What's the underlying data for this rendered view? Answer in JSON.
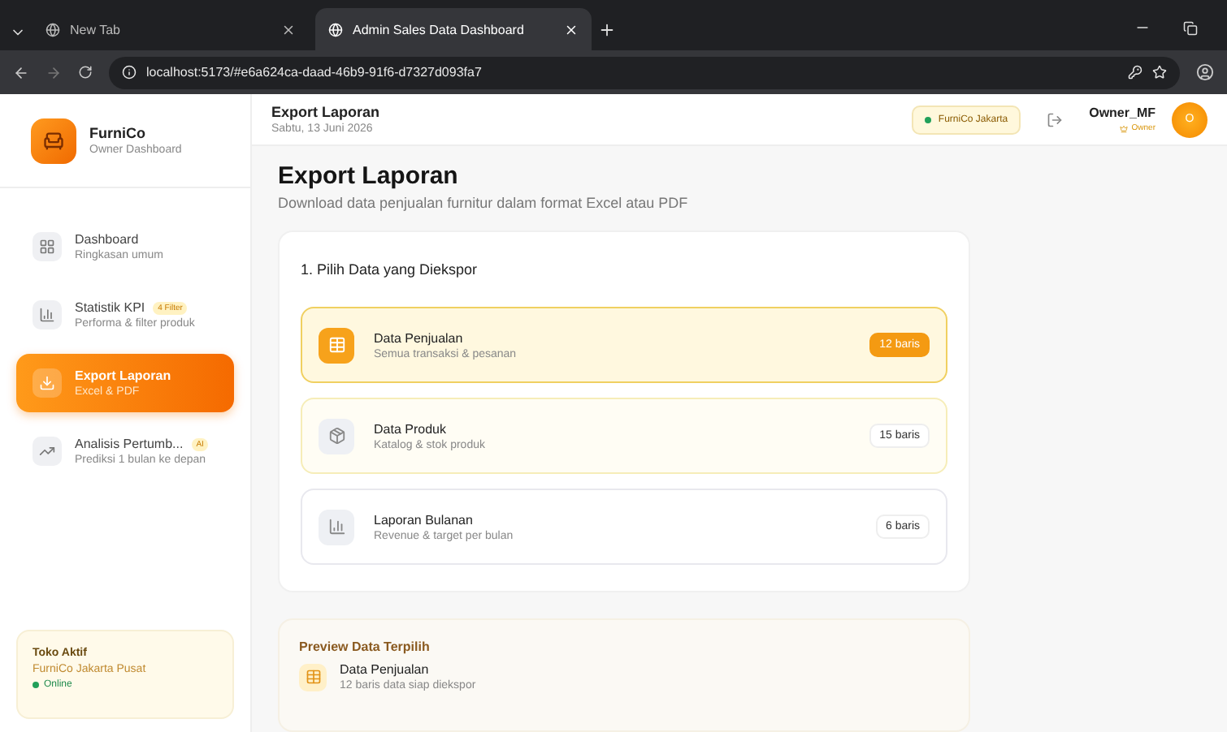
{
  "browser": {
    "tabs": [
      {
        "title": "New Tab",
        "selected": false
      },
      {
        "title": "Admin Sales Data Dashboard",
        "selected": true
      }
    ],
    "url": "localhost:5173/#e6a624ca-daad-46b9-91f6-d7327d093fa7"
  },
  "sidebar": {
    "brand": {
      "name": "FurniCo",
      "subtitle": "Owner Dashboard"
    },
    "nav": [
      {
        "kind": "grid",
        "title": "Dashboard",
        "subtitle": "Ringkasan umum",
        "selected": false
      },
      {
        "kind": "bars",
        "title": "Statistik KPI",
        "badge": "4 Filter",
        "subtitle": "Performa & filter produk",
        "selected": false
      },
      {
        "kind": "download",
        "title": "Export Laporan",
        "subtitle": "Excel & PDF",
        "selected": true
      },
      {
        "kind": "trend",
        "title": "Analisis Pertumb...",
        "badge": "AI",
        "subtitle": "Prediksi 1 bulan ke depan",
        "selected": false
      }
    ],
    "store": {
      "label": "Toko Aktif",
      "name": "FurniCo Jakarta Pusat",
      "status": "Online"
    }
  },
  "header": {
    "title": "Export Laporan",
    "date": "Sabtu, 13 Juni 2026",
    "store_chip": "FurniCo Jakarta",
    "user": {
      "name": "Owner_MF",
      "role": "Owner",
      "initial": "O"
    }
  },
  "page": {
    "title": "Export Laporan",
    "subtitle": "Download data penjualan furnitur dalam format Excel atau PDF"
  },
  "section": {
    "title": "1. Pilih Data yang Diekspor",
    "options": [
      {
        "kind": "table",
        "title": "Data Penjualan",
        "subtitle": "Semua transaksi & pesanan",
        "count": "12 baris",
        "selected": true,
        "hovered": false
      },
      {
        "kind": "box",
        "title": "Data Produk",
        "subtitle": "Katalog & stok produk",
        "count": "15 baris",
        "selected": false,
        "hovered": true
      },
      {
        "kind": "bars",
        "title": "Laporan Bulanan",
        "subtitle": "Revenue & target per bulan",
        "count": "6 baris",
        "selected": false,
        "hovered": false
      }
    ]
  },
  "preview": {
    "title": "Preview Data Terpilih",
    "item": {
      "kind": "table",
      "title": "Data Penjualan",
      "subtitle": "12 baris data siap diekspor"
    }
  }
}
